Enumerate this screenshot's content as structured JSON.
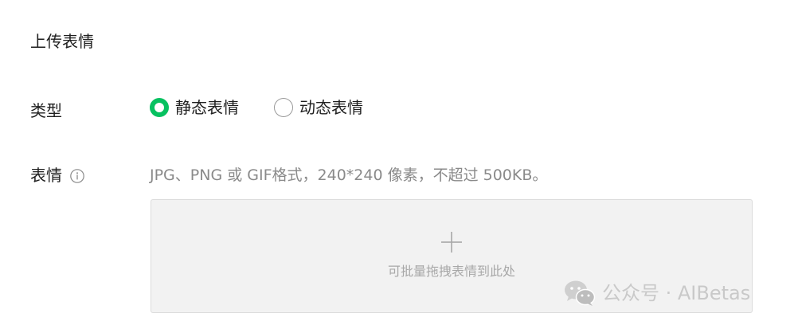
{
  "page": {
    "title": "上传表情"
  },
  "type_row": {
    "label": "类型",
    "options": [
      {
        "label": "静态表情",
        "selected": true
      },
      {
        "label": "动态表情",
        "selected": false
      }
    ]
  },
  "emoji_row": {
    "label": "表情",
    "info_icon": "info-circle-icon",
    "hint": "JPG、PNG 或 GIF格式，240*240 像素，不超过 500KB。"
  },
  "dropzone": {
    "icon": "plus-icon",
    "text": "可批量拖拽表情到此处"
  },
  "watermark": {
    "icon": "wechat-icon",
    "text": "公众号 · AIBetas"
  },
  "colors": {
    "accent": "#07c160",
    "hint": "#8a8a8a",
    "dropzone_bg": "#f2f2f2"
  }
}
